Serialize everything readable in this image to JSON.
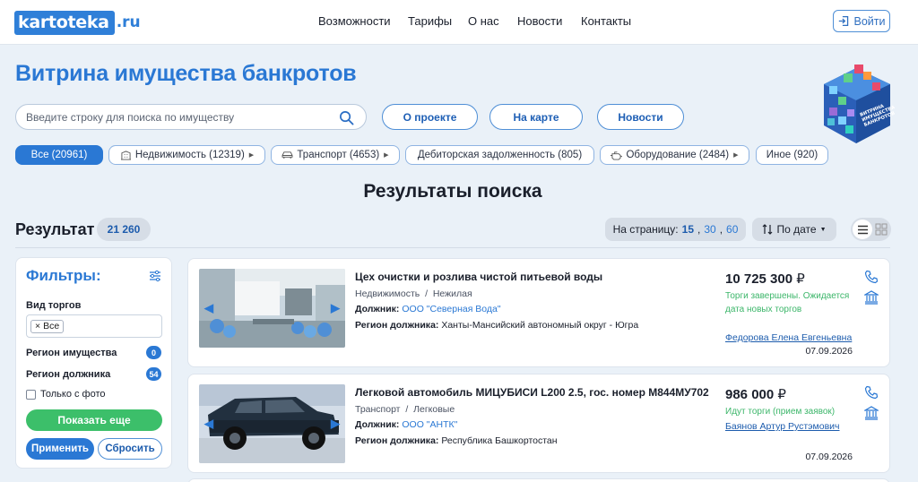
{
  "header": {
    "logo_main": "kartoteka",
    "logo_tld": ".ru",
    "nav": [
      "Возможности",
      "Тарифы",
      "О нас",
      "Новости",
      "Контакты"
    ],
    "login_label": "Войти"
  },
  "page": {
    "title": "Витрина имущества банкротов",
    "search_placeholder": "Введите строку для поиска по имуществу",
    "buttons": [
      "О проекте",
      "На карте",
      "Новости"
    ],
    "cube_text": "ВИТРИНА ИМУЩЕСТВА БАНКРОТОВ"
  },
  "categories": [
    {
      "label": "Все (20961)",
      "icon": "",
      "active": true
    },
    {
      "label": "Недвижимость (12319)",
      "icon": "building-icon",
      "active": false
    },
    {
      "label": "Транспорт (4653)",
      "icon": "car-icon",
      "active": false
    },
    {
      "label": "Дебиторская задолженность (805)",
      "icon": "",
      "active": false
    },
    {
      "label": "Оборудование (2484)",
      "icon": "engine-icon",
      "active": false
    },
    {
      "label": "Иное (920)",
      "icon": "",
      "active": false
    }
  ],
  "results": {
    "heading": "Результаты поиска",
    "label": "Результат",
    "count": "21 260",
    "per_page_label": "На страницу:",
    "per_page_options": [
      "15",
      "30",
      "60"
    ],
    "per_page_selected": "15",
    "sort_label": "По дате"
  },
  "filters": {
    "title": "Фильтры:",
    "trade_type_label": "Вид торгов",
    "trade_type_value": "Все",
    "region_property_label": "Регион имущества",
    "region_property_count": "0",
    "region_debtor_label": "Регион должника",
    "region_debtor_count": "54",
    "photo_only_label": "Только с фото",
    "show_more": "Показать еще",
    "apply": "Применить",
    "reset": "Сбросить"
  },
  "items": [
    {
      "title": "Цех очистки и розлива чистой питьевой воды",
      "category": "Недвижимость",
      "subcategory": "Нежилая",
      "debtor_label": "Должник:",
      "debtor": "ООО \"Северная Вода\"",
      "region_label": "Регион должника:",
      "region": "Ханты-Мансийский автономный округ - Югра",
      "price": "10 725 300",
      "currency": "₽",
      "status": "Торги завершены. Ожидается дата новых торгов",
      "status_color": "#3cb66a",
      "manager": "Федорова Елена Евгеньевна",
      "date": "07.09.2026"
    },
    {
      "title": "Легковой автомобиль МИЦУБИСИ L200 2.5, гос. номер М844МУ702",
      "category": "Транспорт",
      "subcategory": "Легковые",
      "debtor_label": "Должник:",
      "debtor": "ООО \"АНТК\"",
      "region_label": "Регион должника:",
      "region": "Республика Башкортостан",
      "price": "986 000",
      "currency": "₽",
      "status": "Идут торги (прием заявок)",
      "status_color": "#3cb66a",
      "manager": "Баянов Артур Рустэмович",
      "date": "07.09.2026"
    }
  ],
  "colors": {
    "accent": "#2a78d4",
    "success": "#3cbf6a",
    "background": "#eaf1f8"
  }
}
